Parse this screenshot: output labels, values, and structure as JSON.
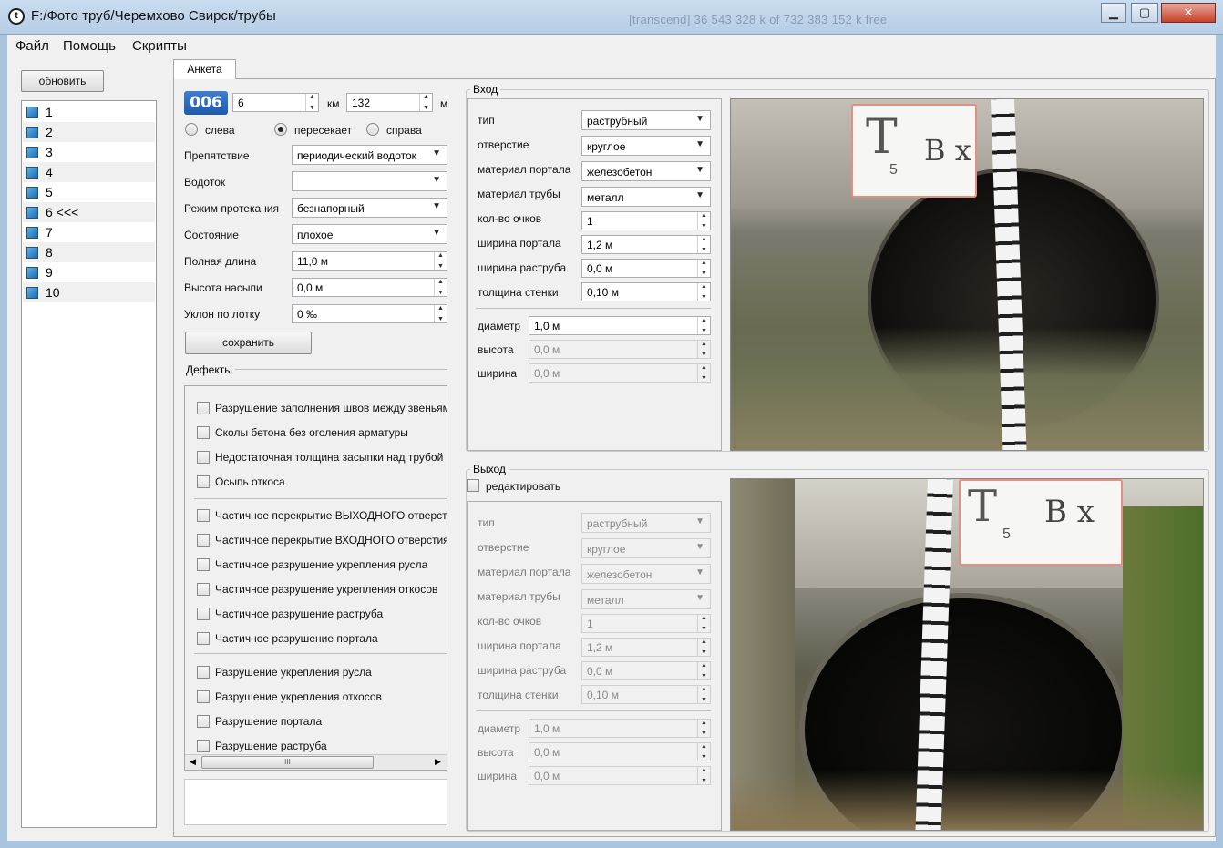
{
  "window": {
    "title": "F:/Фото труб/Черемхово Свирск/трубы",
    "background_text": "[transcend] 36 543 328 k of 732 383 152 k free"
  },
  "menu": [
    "Файл",
    "Помощь",
    "Скрипты"
  ],
  "left": {
    "refresh_label": "обновить",
    "items": [
      "1",
      "2",
      "3",
      "4",
      "5",
      "6 <<<",
      "7",
      "8",
      "9",
      "10"
    ]
  },
  "tab_label": "Анкета",
  "form": {
    "badge": "006",
    "km_value": "6",
    "km_unit": "км",
    "m_value": "132",
    "m_unit": "м",
    "radio_left": "слева",
    "radio_cross": "пересекает",
    "radio_right": "справа",
    "obstacle_label": "Препятствие",
    "obstacle_value": "периодический водоток",
    "watercourse_label": "Водоток",
    "watercourse_value": "",
    "flow_label": "Режим протекания",
    "flow_value": "безнапорный",
    "state_label": "Состояние",
    "state_value": "плохое",
    "length_label": "Полная длина",
    "length_value": "11,0 м",
    "height_label": "Высота насыпи",
    "height_value": "0,0 м",
    "slope_label": "Уклон по лотку",
    "slope_value": "0 ‰",
    "save_label": "сохранить"
  },
  "defects": {
    "title": "Дефекты",
    "group1": [
      "Разрушение заполнения швов между звеньями",
      "Сколы бетона без оголения арматуры",
      "Недостаточная толщина засыпки над трубой",
      "Осыпь откоса"
    ],
    "group2": [
      "Частичное перекрытие ВЫХОДНОГО отверстия",
      "Частичное перекрытие ВХОДНОГО отверстия",
      "Частичное разрушение укрепления русла",
      "Частичное разрушение укрепления откосов",
      "Частичное разрушение раструба",
      "Частичное разрушение портала"
    ],
    "group3": [
      "Разрушение укрепления русла",
      "Разрушение укрепления откосов",
      "Разрушение портала",
      "Разрушение раструба"
    ],
    "scroll_grip": "III"
  },
  "entry": {
    "title": "Вход",
    "fields": {
      "type_label": "тип",
      "type_value": "раструбный",
      "hole_label": "отверстие",
      "hole_value": "круглое",
      "portal_mat_label": "материал портала",
      "portal_mat_value": "железобетон",
      "pipe_mat_label": "материал трубы",
      "pipe_mat_value": "металл",
      "count_label": "кол-во очков",
      "count_value": "1",
      "portal_w_label": "ширина портала",
      "portal_w_value": "1,2 м",
      "bell_w_label": "ширина раструба",
      "bell_w_value": "0,0 м",
      "wall_label": "толщина стенки",
      "wall_value": "0,10 м",
      "diam_label": "диаметр",
      "diam_value": "1,0 м",
      "h_label": "высота",
      "h_value": "0,0 м",
      "w_label": "ширина",
      "w_value": "0,0 м"
    }
  },
  "exit": {
    "title": "Выход",
    "edit_label": "редактировать",
    "fields": {
      "type_label": "тип",
      "type_value": "раструбный",
      "hole_label": "отверстие",
      "hole_value": "круглое",
      "portal_mat_label": "материал портала",
      "portal_mat_value": "железобетон",
      "pipe_mat_label": "материал трубы",
      "pipe_mat_value": "металл",
      "count_label": "кол-во очков",
      "count_value": "1",
      "portal_w_label": "ширина портала",
      "portal_w_value": "1,2 м",
      "bell_w_label": "ширина раструба",
      "bell_w_value": "0,0 м",
      "wall_label": "толщина стенки",
      "wall_value": "0,10 м",
      "diam_label": "диаметр",
      "diam_value": "1,0 м",
      "h_label": "высота",
      "h_value": "0,0 м",
      "w_label": "ширина",
      "w_value": "0,0 м"
    }
  },
  "photos": {
    "entry_sign_main": "T",
    "entry_sign_sub": "5",
    "entry_sign_tail": "B x",
    "exit_sign_main": "T",
    "exit_sign_sub": "5",
    "exit_sign_tail": "B x"
  }
}
